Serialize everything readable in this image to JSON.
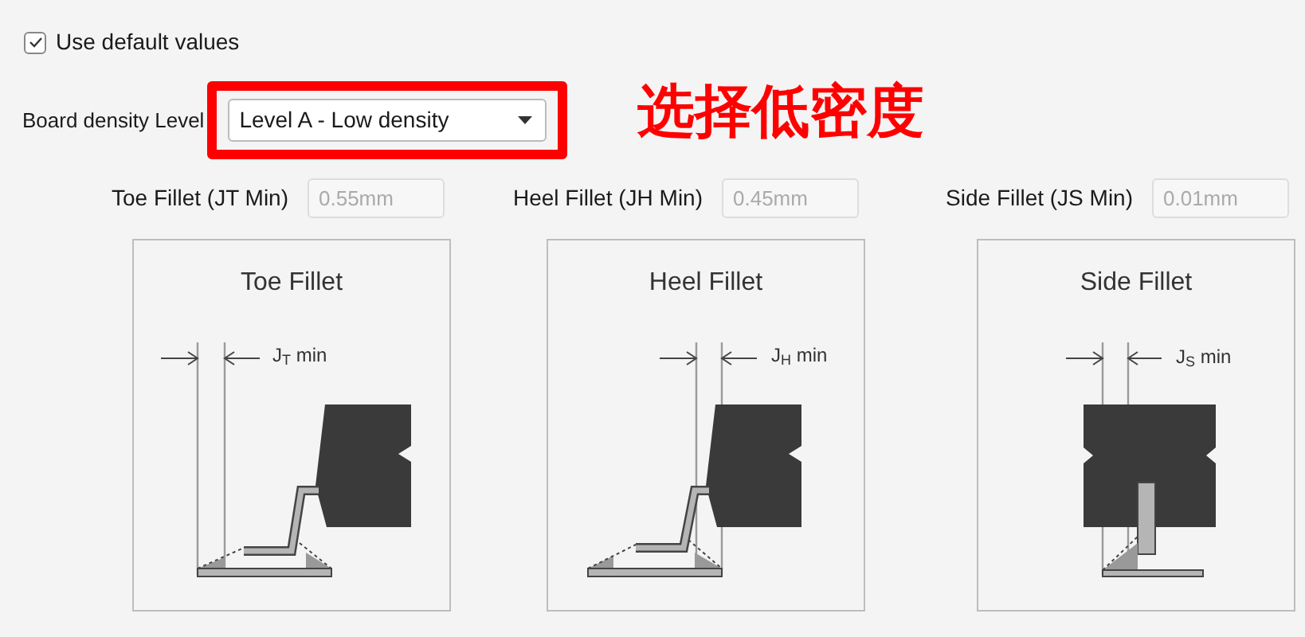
{
  "checkbox": {
    "label": "Use default values",
    "checked": true
  },
  "density": {
    "label": "Board density Level",
    "value": "Level A - Low density"
  },
  "annotation": "选择低密度",
  "fields": [
    {
      "label": "Toe Fillet (JT Min)",
      "value": "0.55mm",
      "disabled": true
    },
    {
      "label": "Heel Fillet (JH Min)",
      "value": "0.45mm",
      "disabled": true
    },
    {
      "label": "Side Fillet (JS Min)",
      "value": "0.01mm",
      "disabled": true
    }
  ],
  "diagrams": [
    {
      "kind": "toe",
      "title": "Toe Fillet",
      "dimension": "J$_{T}$ min"
    },
    {
      "kind": "heel",
      "title": "Heel Fillet",
      "dimension": "J$_{H}$ min"
    },
    {
      "kind": "side",
      "title": "Side Fillet",
      "dimension": "J$_{S}$ min"
    }
  ]
}
